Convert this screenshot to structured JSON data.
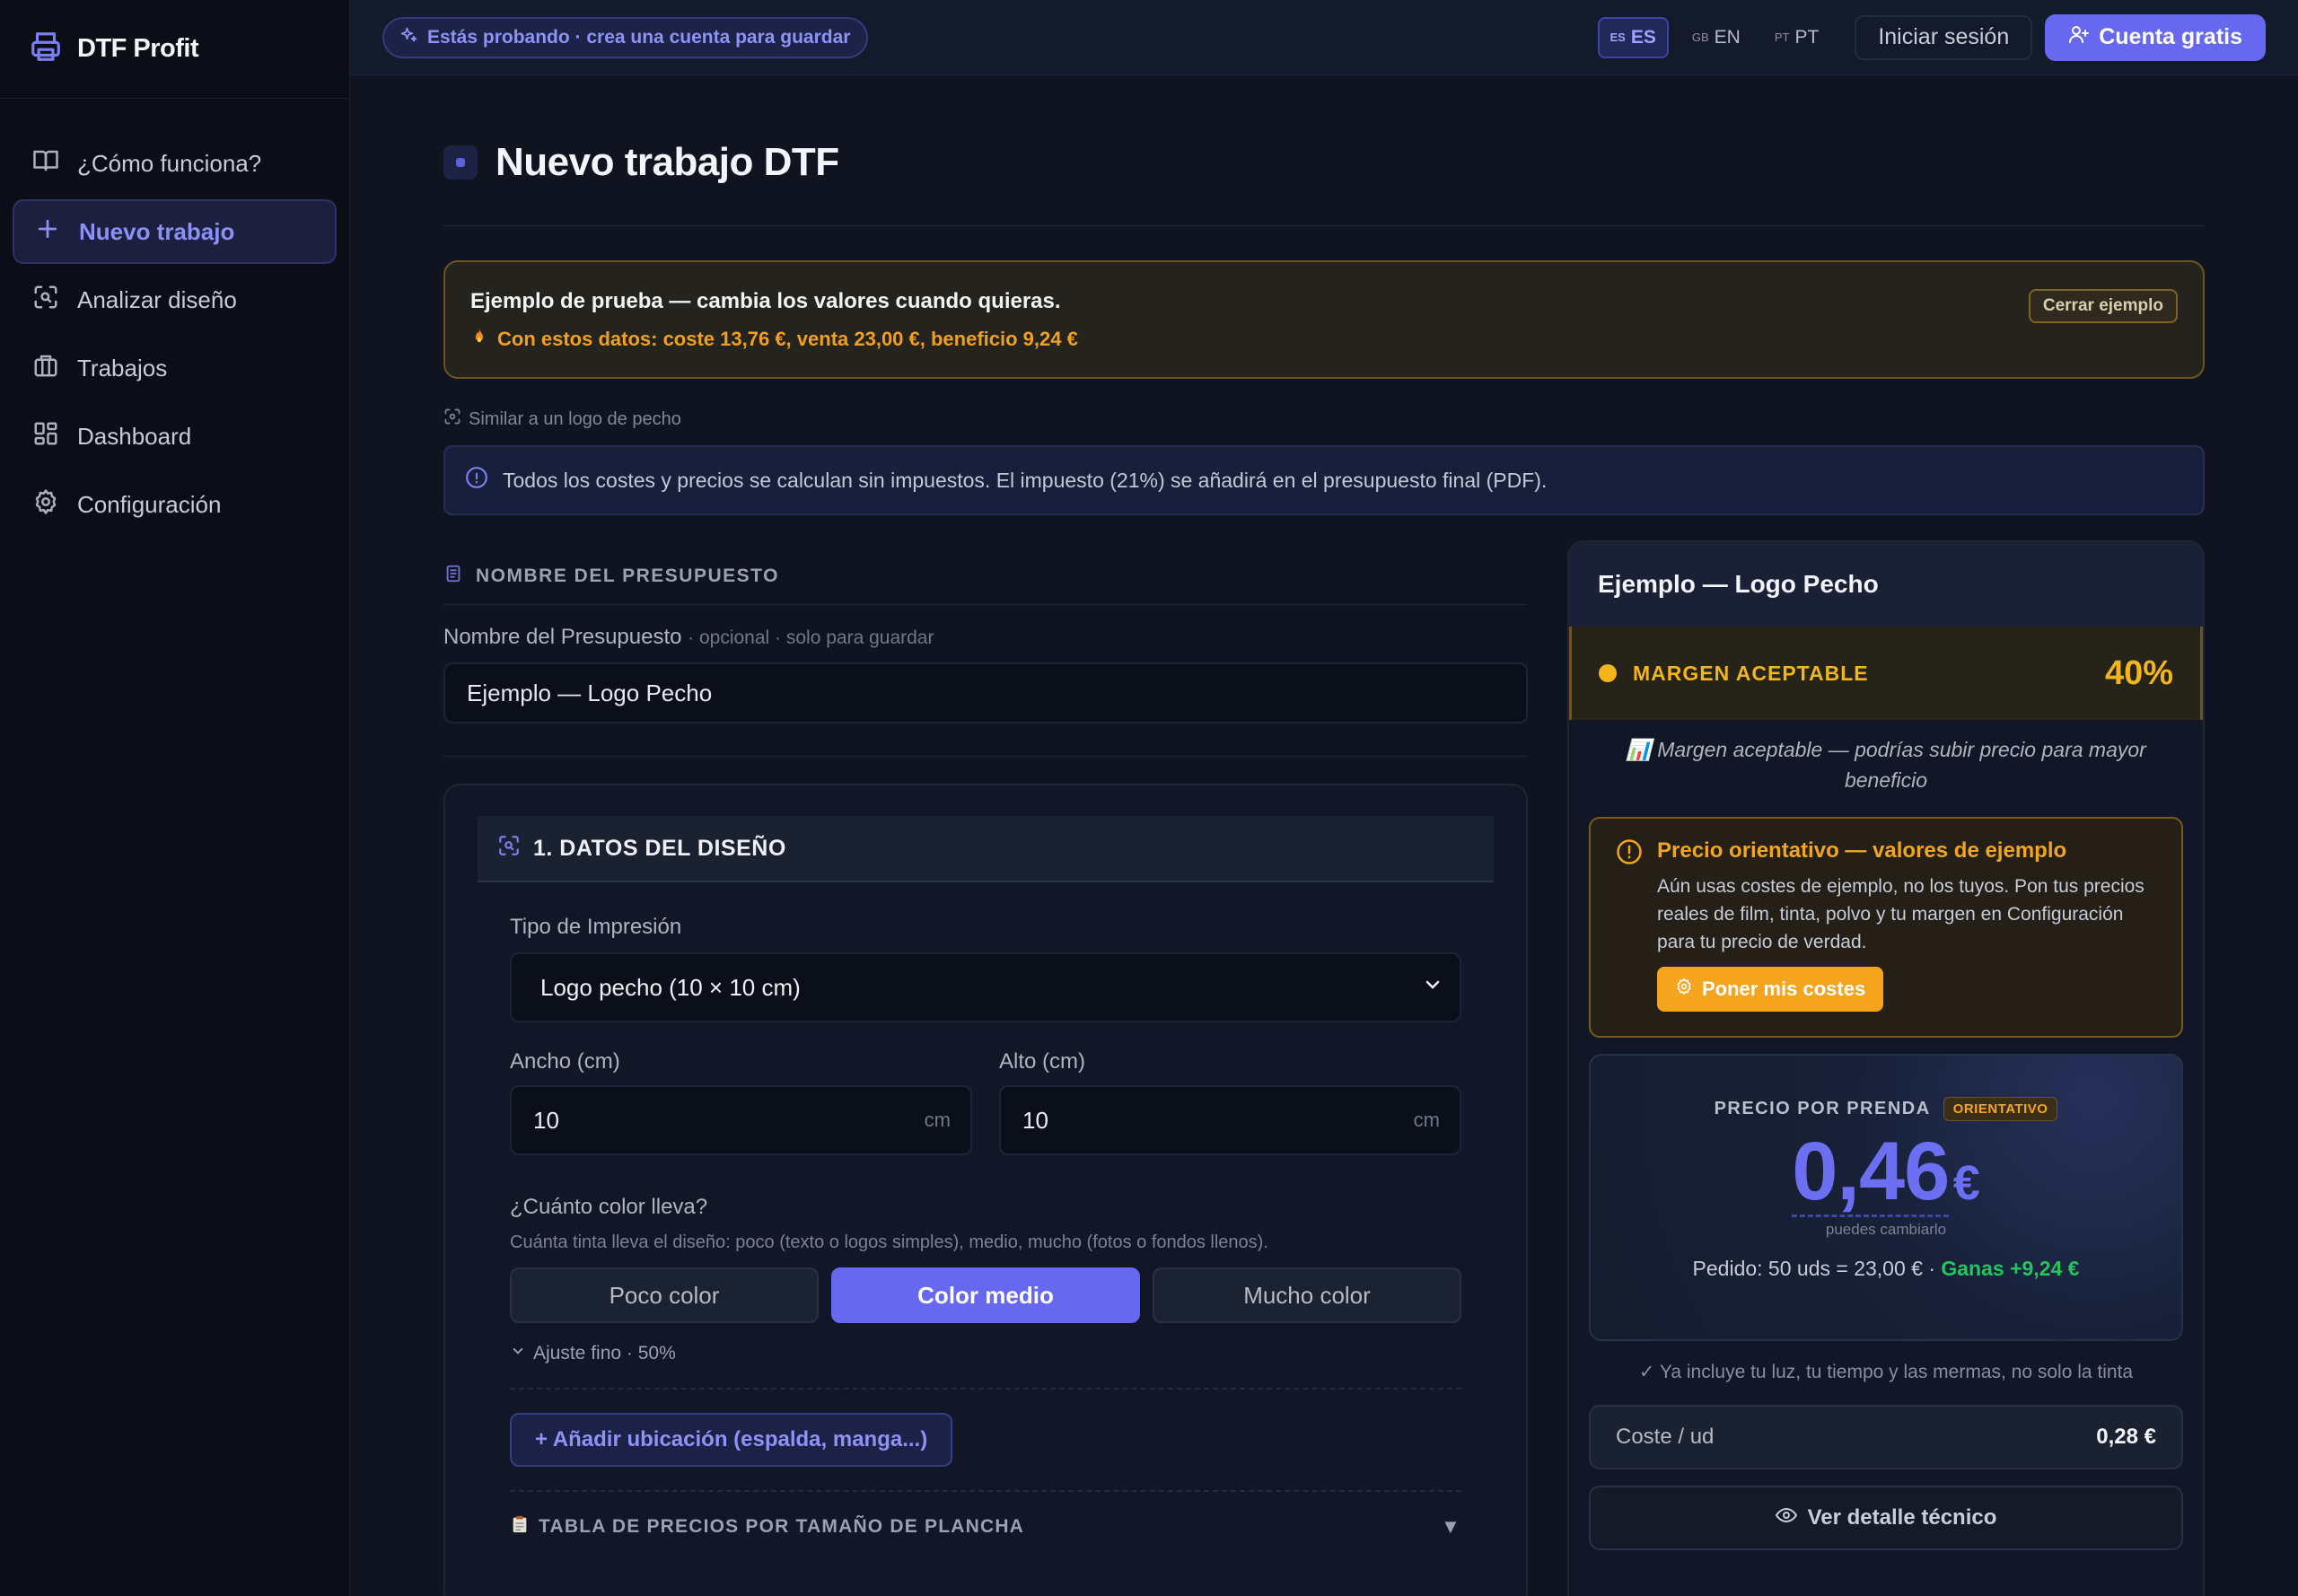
{
  "brand": {
    "name": "DTF Profit",
    "icon": "printer-icon"
  },
  "sidebar": {
    "items": [
      {
        "label": "¿Cómo funciona?",
        "icon": "book-icon",
        "active": false
      },
      {
        "label": "Nuevo trabajo",
        "icon": "plus-icon",
        "active": true
      },
      {
        "label": "Analizar diseño",
        "icon": "scan-icon",
        "active": false
      },
      {
        "label": "Trabajos",
        "icon": "briefcase-icon",
        "active": false
      },
      {
        "label": "Dashboard",
        "icon": "grid-icon",
        "active": false
      },
      {
        "label": "Configuración",
        "icon": "gear-icon",
        "active": false
      }
    ]
  },
  "topbar": {
    "trial": "Estás probando · crea una cuenta para guardar",
    "langs": [
      {
        "code": "ES",
        "label": "ES",
        "active": true
      },
      {
        "code": "GB",
        "label": "EN",
        "active": false
      },
      {
        "code": "PT",
        "label": "PT",
        "active": false
      }
    ],
    "login": "Iniciar sesión",
    "signup": "Cuenta gratis"
  },
  "page": {
    "title": "Nuevo trabajo DTF",
    "example": {
      "title": "Ejemplo de prueba — cambia los valores cuando quieras.",
      "summary": "Con estos datos: coste 13,76 €, venta 23,00 €, beneficio 9,24 €",
      "close": "Cerrar ejemplo"
    },
    "similar": "Similar a un logo de pecho",
    "tax_info": "Todos los costes y precios se calculan sin impuestos. El impuesto (21%) se añadirá en el presupuesto final (PDF)."
  },
  "budget": {
    "section": "NOMBRE DEL PRESUPUESTO",
    "label": "Nombre del Presupuesto",
    "label_hint": "· opcional · solo para guardar",
    "value": "Ejemplo — Logo Pecho"
  },
  "design": {
    "title": "1. DATOS DEL DISEÑO",
    "print_type_label": "Tipo de Impresión",
    "print_type_value": "Logo pecho (10 × 10 cm)",
    "width_label": "Ancho (cm)",
    "width_value": "10",
    "height_label": "Alto (cm)",
    "height_value": "10",
    "unit": "cm",
    "color_label": "¿Cuánto color lleva?",
    "color_hint": "Cuánta tinta lleva el diseño: poco (texto o logos simples), medio, mucho (fotos o fondos llenos).",
    "color_options": [
      "Poco color",
      "Color medio",
      "Mucho color"
    ],
    "color_selected": "Color medio",
    "fine_tune": "Ajuste fino · 50%",
    "add_location": "+ Añadir ubicación (espalda, manga...)",
    "price_table": "TABLA DE PRECIOS POR TAMAÑO DE PLANCHA",
    "price_table_icon": "clipboard-icon"
  },
  "result": {
    "title": "Ejemplo — Logo Pecho",
    "margin_label": "MARGEN ACEPTABLE",
    "margin_pct": "40%",
    "margin_note": "📊 Margen aceptable — podrías subir precio para mayor beneficio",
    "warning_title": "Precio orientativo — valores de ejemplo",
    "warning_text": "Aún usas costes de ejemplo, no los tuyos. Pon tus precios reales de film, tinta, polvo y tu margen en Configuración para tu precio de verdad.",
    "warning_button": "Poner mis costes",
    "price_label": "PRECIO POR PRENDA",
    "price_badge": "ORIENTATIVO",
    "price_value": "0,46",
    "currency": "€",
    "price_hint": "puedes cambiarlo",
    "order_text": "Pedido: 50 uds = 23,00 € ·",
    "order_gain": "Ganas +9,24 €",
    "includes": "✓ Ya incluye tu luz, tu tiempo y las mermas, no solo la tinta",
    "cost_label": "Coste / ud",
    "cost_value": "0,28 €",
    "detail_button": "Ver detalle técnico"
  },
  "colors": {
    "accent": "#6668ef",
    "warning": "#f2a51f",
    "success": "#22c55e",
    "background": "#0f1420"
  }
}
